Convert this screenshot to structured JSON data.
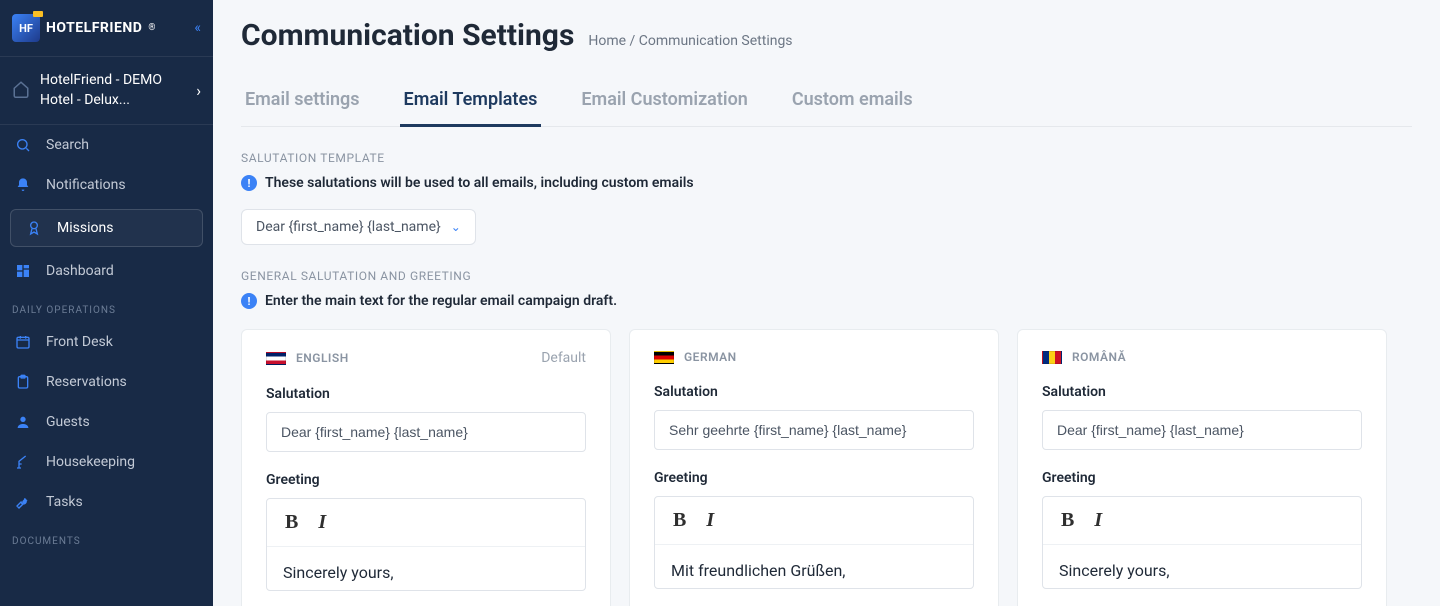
{
  "logo_text": "HOTELFRIEND",
  "hotel_name": "HotelFriend - DEMO Hotel - Delux...",
  "nav": {
    "search": "Search",
    "notifications": "Notifications",
    "missions": "Missions",
    "dashboard": "Dashboard"
  },
  "sections": {
    "daily_ops": "DAILY OPERATIONS",
    "documents": "DOCUMENTS"
  },
  "daily_ops": {
    "front_desk": "Front Desk",
    "reservations": "Reservations",
    "guests": "Guests",
    "housekeeping": "Housekeeping",
    "tasks": "Tasks"
  },
  "page_title": "Communication Settings",
  "breadcrumb": {
    "home": "Home",
    "sep": "/",
    "current": "Communication Settings"
  },
  "tabs": {
    "email_settings": "Email settings",
    "email_templates": "Email Templates",
    "email_customization": "Email Customization",
    "custom_emails": "Custom emails"
  },
  "salutation_template_label": "SALUTATION TEMPLATE",
  "salutation_template_info": "These salutations will be used to all emails, including custom emails",
  "salutation_dropdown": "Dear {first_name} {last_name}",
  "general_label": "GENERAL SALUTATION AND GREETING",
  "general_info": "Enter the main text for the regular email campaign draft.",
  "default_badge": "Default",
  "labels": {
    "salutation": "Salutation",
    "greeting": "Greeting"
  },
  "cards": [
    {
      "lang": "ENGLISH",
      "flag": "uk",
      "default": true,
      "salutation": "Dear {first_name} {last_name}",
      "greeting_body": "Sincerely yours,"
    },
    {
      "lang": "GERMAN",
      "flag": "de",
      "default": false,
      "salutation": "Sehr geehrte {first_name} {last_name}",
      "greeting_body": "Mit freundlichen Grüßen,"
    },
    {
      "lang": "ROMÂNĂ",
      "flag": "ro",
      "default": false,
      "salutation": "Dear {first_name} {last_name}",
      "greeting_body": "Sincerely yours,"
    }
  ]
}
